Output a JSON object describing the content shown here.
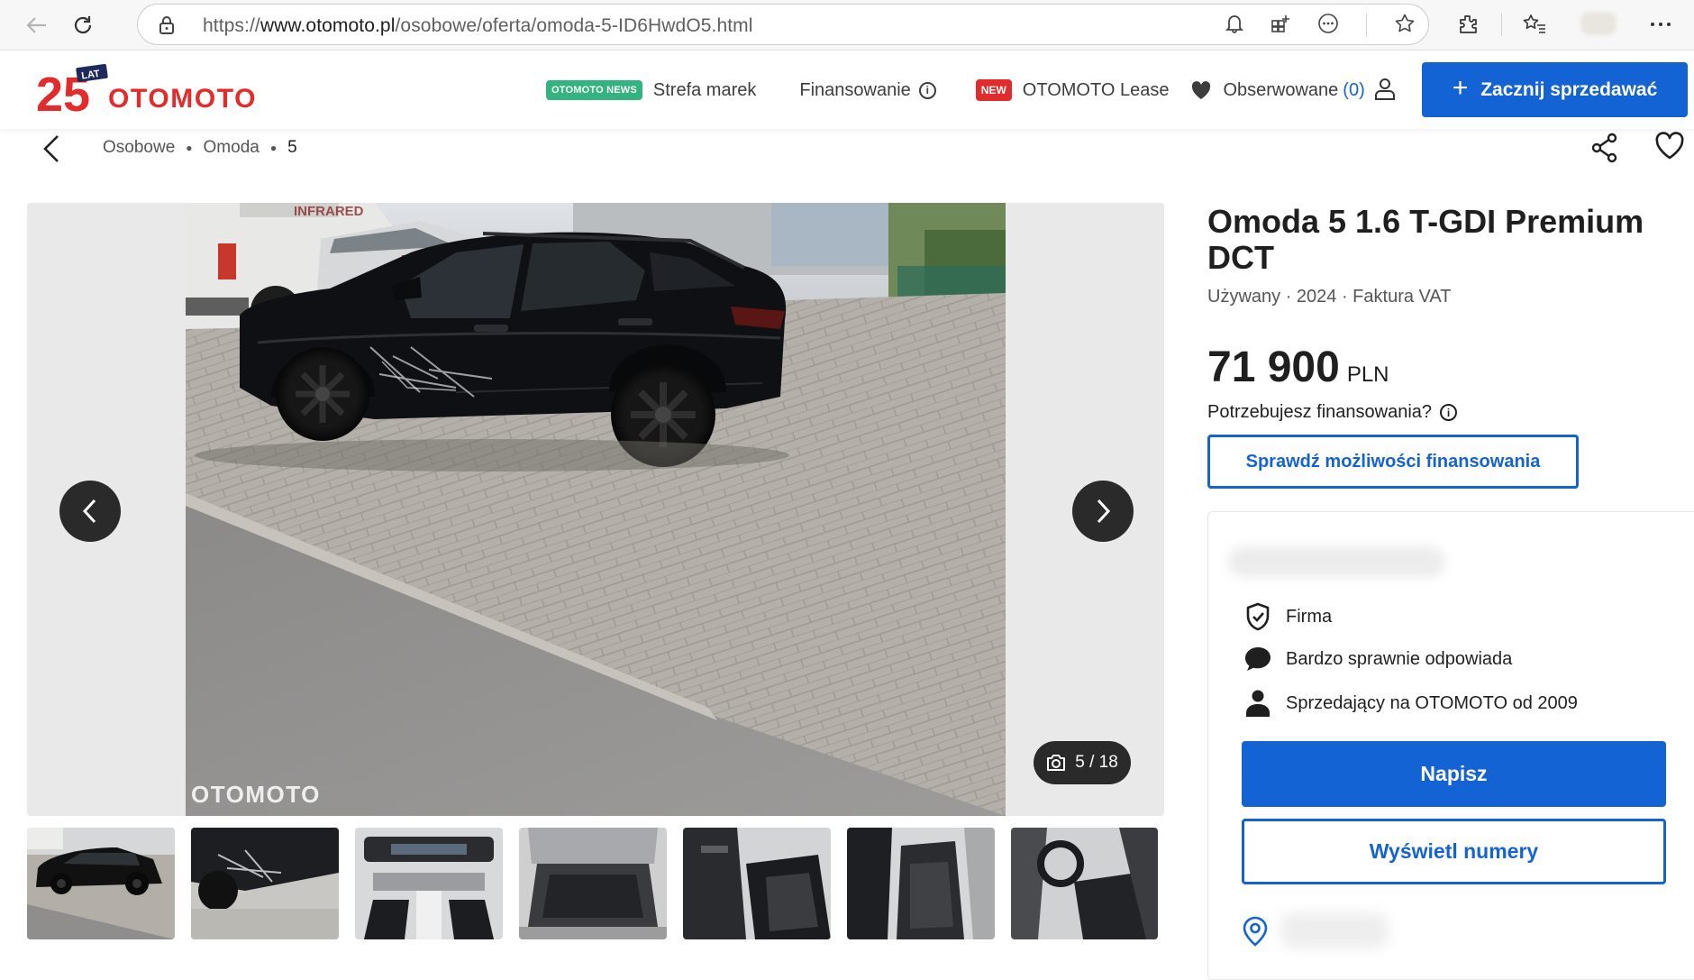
{
  "browser": {
    "url_prefix": "https://",
    "url_host": "www.otomoto.pl",
    "url_path": "/osobowe/oferta/omoda-5-ID6HwdO5.html"
  },
  "header": {
    "logo_text": "OTOMOTO",
    "logo_anniversary": "25",
    "logo_anniversary_suffix": "LAT",
    "news_badge": "OTOMOTO NEWS",
    "nav_brands": "Strefa marek",
    "nav_financing": "Finansowanie",
    "new_badge": "NEW",
    "nav_lease": "OTOMOTO Lease",
    "nav_observed": "Obserwowane",
    "observed_count": "(0)",
    "sell_button": "Zacznij sprzedawać"
  },
  "breadcrumb": {
    "items": [
      "Osobowe",
      "Omoda",
      "5"
    ]
  },
  "gallery": {
    "counter": "5 / 18",
    "watermark": "OTOMOTO",
    "thumbnail_count": 7
  },
  "listing": {
    "title": "Omoda 5 1.6 T-GDI Premium DCT",
    "subtitle": "Używany · 2024 · Faktura VAT",
    "price": "71 900",
    "currency": "PLN",
    "financing_question": "Potrzebujesz finansowania?",
    "financing_button": "Sprawdź możliwości finansowania"
  },
  "seller": {
    "type": "Firma",
    "response": "Bardzo sprawnie odpowiada",
    "since": "Sprzedający na OTOMOTO od 2009",
    "write_button": "Napisz",
    "numbers_button": "Wyświetl numery"
  },
  "colors": {
    "accent": "#1463d4",
    "logo_red": "#e32b2b",
    "logo_navy": "#1f2a5c",
    "news_green": "#33b380"
  }
}
